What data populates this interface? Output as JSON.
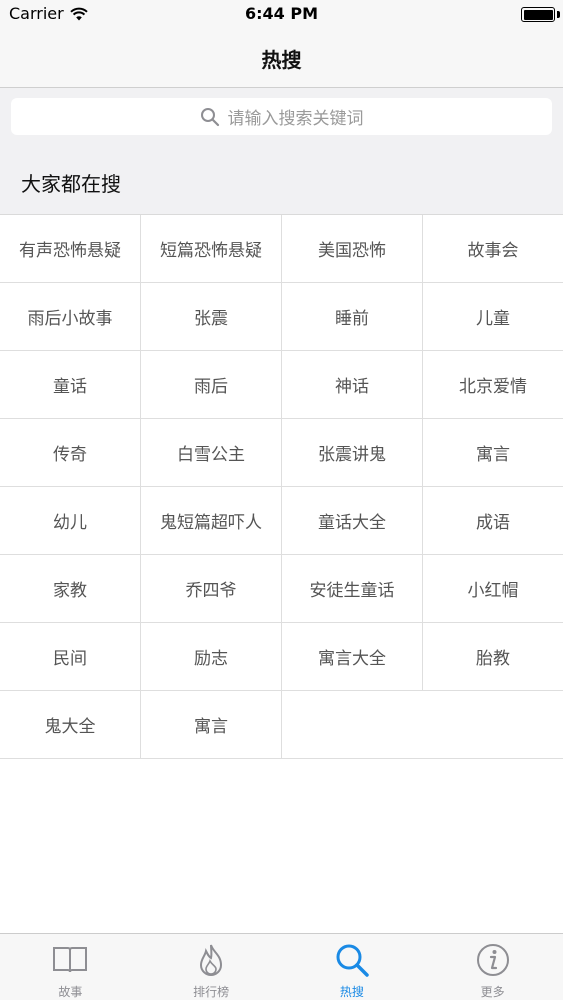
{
  "status_bar": {
    "carrier": "Carrier",
    "time": "6:44 PM",
    "battery_level": 1.0
  },
  "nav": {
    "title": "热搜"
  },
  "search": {
    "placeholder": "请输入搜索关键词"
  },
  "section": {
    "title": "大家都在搜"
  },
  "tags": [
    "有声恐怖悬疑",
    "短篇恐怖悬疑",
    "美国恐怖",
    "故事会",
    "雨后小故事",
    "张震",
    "睡前",
    "儿童",
    "童话",
    "雨后",
    "神话",
    "北京爱情",
    "传奇",
    "白雪公主",
    "张震讲鬼",
    "寓言",
    "幼儿",
    "鬼短篇超吓人",
    "童话大全",
    "成语",
    "家教",
    "乔四爷",
    "安徒生童话",
    "小红帽",
    "民间",
    "励志",
    "寓言大全",
    "胎教",
    "鬼大全",
    "寓言"
  ],
  "tab_bar": {
    "items": [
      {
        "label": "故事",
        "icon": "book-icon",
        "active": false
      },
      {
        "label": "排行榜",
        "icon": "flame-icon",
        "active": false
      },
      {
        "label": "热搜",
        "icon": "search-icon",
        "active": true
      },
      {
        "label": "更多",
        "icon": "info-icon",
        "active": false
      }
    ],
    "active_color": "#1a8ae5",
    "inactive_color": "#8e8e93"
  }
}
